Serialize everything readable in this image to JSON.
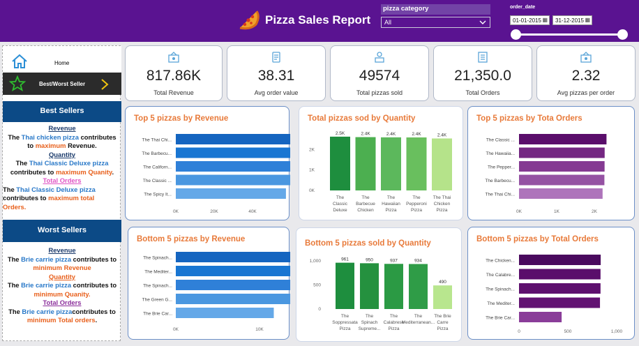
{
  "header": {
    "title": "Pizza Sales Report",
    "category_label": "pizza category",
    "category_value": "All",
    "date_label": "order_date",
    "date_start": "01-01-2015",
    "date_end": "31-12-2015",
    "colors": {
      "bg": "#5a1391"
    }
  },
  "sidebar": {
    "home_label": "Home",
    "best_worst_label": "Best/Worst Seller",
    "best_title": "Best Sellers",
    "worst_title": "Worst Sellers",
    "best": {
      "rev_h": "Revenue",
      "rev_a": "The ",
      "rev_b": "Thai chicken pizza",
      "rev_c": " contributes",
      "rev_d": "to ",
      "rev_e": "maximum",
      "rev_f": " Revenue.",
      "qty_h": "Quantity",
      "qty_a": "The ",
      "qty_b": "Thai Classic Deluxe pizza",
      "qty_c": "contributes to ",
      "qty_d": "maximum Quanity",
      "qty_e": ".",
      "ord_h": "Total Orders",
      "ord_a": "The ",
      "ord_b": "Thai Classic Deluxe pizza",
      "ord_c": "contributes to ",
      "ord_d": "maximum total",
      "ord_e": "Orders."
    },
    "worst": {
      "rev_h": "Revenue",
      "rev_a": "The ",
      "rev_b": "Brie carrie pizza",
      "rev_c": " contributes to",
      "rev_d": "minimum  Revenue",
      "qty_h": "Quantity",
      "qty_a": "The ",
      "qty_b": "Brie carrie pizza",
      "qty_c": " contributes to",
      "qty_d": "minimum Quanity.",
      "ord_h": "Total Orders",
      "ord_a": "The ",
      "ord_b": "Brie carrie pizza",
      "ord_c": "contributes to",
      "ord_d": "minimum Total orders",
      "ord_e": "."
    }
  },
  "kpis": [
    {
      "value": "817.86K",
      "label": "Total Revenue",
      "icon": "pizza-box-icon"
    },
    {
      "value": "38.31",
      "label": "Avg order value",
      "icon": "receipt-icon"
    },
    {
      "value": "49574",
      "label": "Total pizzas sold",
      "icon": "delivery-icon"
    },
    {
      "value": "21,350.0",
      "label": "Total Orders",
      "icon": "order-list-icon"
    },
    {
      "value": "2.32",
      "label": "Avg pizzas per order",
      "icon": "pizza-box-icon"
    }
  ],
  "chart_data": [
    {
      "id": "top5rev",
      "type": "bar",
      "orientation": "horizontal",
      "title": "Top 5 pizzas by Revenue",
      "categories": [
        "The Thai Chi...",
        "The Barbecu...",
        "The Californ...",
        "The Classic ...",
        "The Spicy It..."
      ],
      "values": [
        43434,
        42768,
        41410,
        38180,
        34831
      ],
      "xticks": [
        "0K",
        "20K",
        "40K"
      ],
      "xlim": [
        0,
        45000
      ],
      "colors": [
        "#1565c0",
        "#1976d2",
        "#2f80d8",
        "#4a97e0",
        "#64a8e8"
      ]
    },
    {
      "id": "top5qty",
      "type": "bar",
      "orientation": "vertical",
      "title": "Total pizzas sod by Quantity",
      "categories": [
        "The Classic Deluxe ...",
        "The Barbecue Chicken ...",
        "The Hawaiian Pizza",
        "The Pepperoni Pizza",
        "The Thai Chicken Pizza"
      ],
      "values": [
        2453,
        2432,
        2422,
        2418,
        2371
      ],
      "data_labels": [
        "2.5K",
        "2.4K",
        "2.4K",
        "2.4K",
        "2.4K"
      ],
      "yticks": [
        "0K",
        "1K",
        "2K"
      ],
      "ylim": [
        0,
        2800
      ],
      "colors": [
        "#1e8e3e",
        "#4caf50",
        "#5cb85c",
        "#69bf5e",
        "#b5e38a"
      ]
    },
    {
      "id": "top5ord",
      "type": "bar",
      "orientation": "horizontal",
      "title": "Top 5 pizzas by Tota Orders",
      "categories": [
        "The Classic ...",
        "The Hawaiia...",
        "The Pepper...",
        "The Barbecu...",
        "The Thai Chi..."
      ],
      "values": [
        2329,
        2280,
        2278,
        2273,
        2225
      ],
      "xticks": [
        "0K",
        "1K",
        "2K"
      ],
      "xlim": [
        0,
        2600
      ],
      "colors": [
        "#5a0e6b",
        "#742782",
        "#853a92",
        "#9552a3",
        "#ae74bb"
      ]
    },
    {
      "id": "bot5rev",
      "type": "bar",
      "orientation": "horizontal",
      "title": "Bottom 5 pizzas by Revenue",
      "categories": [
        "The Spinach...",
        "The Mediter...",
        "The Spinach...",
        "The Green G...",
        "The Brie Car..."
      ],
      "values": [
        15277,
        15360,
        15596,
        13955,
        11588
      ],
      "xticks": [
        "0K",
        "10K"
      ],
      "xlim": [
        0,
        16500
      ],
      "colors": [
        "#1565c0",
        "#1976d2",
        "#2f80d8",
        "#4a97e0",
        "#64a8e8"
      ]
    },
    {
      "id": "bot5qty",
      "type": "bar",
      "orientation": "vertical",
      "title": "Bottom 5 pizzas sold by Quantity",
      "categories": [
        "The Soppressata Pizza",
        "The Spinach Supreme...",
        "The Calabrese Pizza",
        "The Mediterranean...",
        "The Brie Carre Pizza"
      ],
      "values": [
        961,
        950,
        937,
        934,
        490
      ],
      "data_labels": [
        "961",
        "950",
        "937",
        "934",
        "490"
      ],
      "yticks": [
        "0",
        "500",
        "1,000"
      ],
      "ylim": [
        0,
        1100
      ],
      "colors": [
        "#1e8e3e",
        "#25913f",
        "#2b9a44",
        "#2f9c47",
        "#b8e68e"
      ]
    },
    {
      "id": "bot5ord",
      "type": "bar",
      "orientation": "horizontal",
      "title": "Bottom 5 pizzas by Total Orders",
      "categories": [
        "The Chicken...",
        "The Calabre...",
        "The Spinach...",
        "The Mediter...",
        "The Brie Car..."
      ],
      "values": [
        920,
        918,
        918,
        912,
        480
      ],
      "xticks": [
        "0",
        "500",
        "1,000"
      ],
      "xlim": [
        0,
        1100
      ],
      "colors": [
        "#4a0a5e",
        "#5a0e6b",
        "#5e106e",
        "#621272",
        "#8a3d99"
      ]
    }
  ]
}
